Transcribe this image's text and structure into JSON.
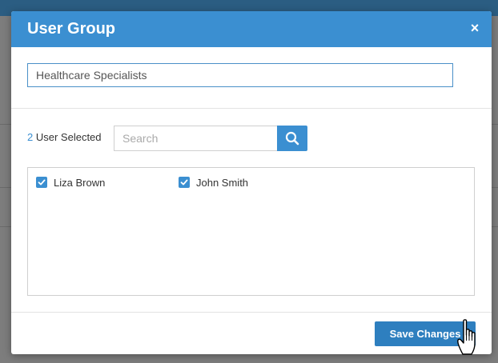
{
  "dialog": {
    "title": "User Group",
    "close_glyph": "×",
    "group_name_value": "Healthcare Specialists"
  },
  "selection": {
    "count": "2",
    "count_label": "User Selected"
  },
  "search": {
    "placeholder": "Search",
    "icon": "search-icon"
  },
  "users": [
    {
      "name": "Liza Brown",
      "checked": true
    },
    {
      "name": "John Smith",
      "checked": true
    }
  ],
  "footer": {
    "save_label": "Save Changes"
  },
  "colors": {
    "header": "#3b8fd1",
    "accent": "#3b8fd1",
    "save_button": "#2e7fbf",
    "overlay": "#7d7d7d"
  }
}
